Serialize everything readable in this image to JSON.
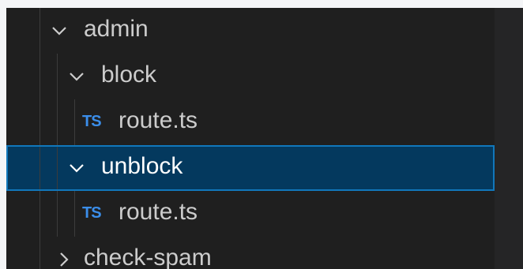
{
  "explorer": {
    "items": [
      {
        "label": "admin",
        "kind": "folder",
        "expanded": true,
        "icon": "chevron-down-icon"
      },
      {
        "label": "block",
        "kind": "folder",
        "expanded": true,
        "icon": "chevron-down-icon"
      },
      {
        "label": "route.ts",
        "kind": "file",
        "badge": "TS",
        "icon": "typescript-file-icon"
      },
      {
        "label": "unblock",
        "kind": "folder",
        "expanded": true,
        "selected": true,
        "icon": "chevron-down-icon"
      },
      {
        "label": "route.ts",
        "kind": "file",
        "badge": "TS",
        "icon": "typescript-file-icon"
      },
      {
        "label": "check-spam",
        "kind": "folder",
        "expanded": false,
        "icon": "chevron-right-icon"
      }
    ]
  },
  "colors": {
    "background": "#1f1f1f",
    "text": "#cccccc",
    "selection_background": "#04395e",
    "selection_border": "#1177bb",
    "ts_badge": "#3b8eea",
    "indent_guide": "#3c3c3c"
  }
}
